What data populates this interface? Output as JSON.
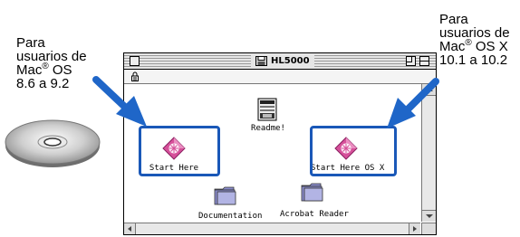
{
  "labels": {
    "left": {
      "line1": "Para",
      "line2": "usuarios de",
      "line3_pre": "Mac",
      "line3_sup": "®",
      "line3_post": " OS",
      "line4": "8.6 a 9.2"
    },
    "right": {
      "line1": "Para",
      "line2": "usuarios de",
      "line3_pre": "Mac",
      "line3_sup": "®",
      "line3_post": " OS X",
      "line4": "10.1 a 10.2"
    }
  },
  "window": {
    "title": "HL5000",
    "items": [
      {
        "label": "Readme!",
        "icon": "document-icon"
      },
      {
        "label": "Start Here",
        "icon": "start-here-icon"
      },
      {
        "label": "Start Here OS X",
        "icon": "start-here-icon"
      },
      {
        "label": "Documentation",
        "icon": "folder-icon"
      },
      {
        "label": "Acrobat Reader",
        "icon": "folder-icon"
      }
    ]
  },
  "colors": {
    "highlight": "#1a58b8",
    "arrow": "#1f66c8",
    "folder": "#8a8ccc",
    "start_here": "#d6509a"
  }
}
